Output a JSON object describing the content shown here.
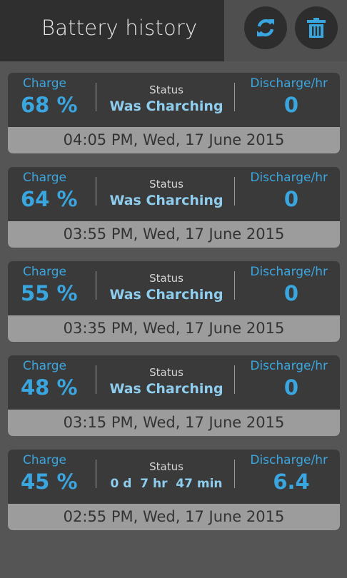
{
  "header": {
    "title": "Battery history",
    "buttons": {
      "refresh_icon": "refresh-icon",
      "delete_icon": "trash-icon"
    }
  },
  "colors": {
    "accent": "#3aa6e0",
    "status_value": "#8fcdee",
    "card_bg": "#3a3a3a",
    "time_bg": "#9c9c9c"
  },
  "labels": {
    "charge": "Charge",
    "status": "Status",
    "discharge": "Discharge/hr"
  },
  "entries": [
    {
      "charge": "68 %",
      "status": "Was Charching",
      "discharge": "0",
      "time": "04:05 PM, Wed, 17 June 2015"
    },
    {
      "charge": "64 %",
      "status": "Was Charching",
      "discharge": "0",
      "time": "03:55 PM, Wed, 17 June 2015"
    },
    {
      "charge": "55 %",
      "status": "Was Charching",
      "discharge": "0",
      "time": "03:35 PM, Wed, 17 June 2015"
    },
    {
      "charge": "48 %",
      "status": "Was Charching",
      "discharge": "0",
      "time": "03:15 PM, Wed, 17 June 2015"
    },
    {
      "charge": "45 %",
      "status": "0 d  7 hr  47 min",
      "discharge": "6.4",
      "time": "02:55 PM, Wed, 17 June 2015"
    }
  ]
}
